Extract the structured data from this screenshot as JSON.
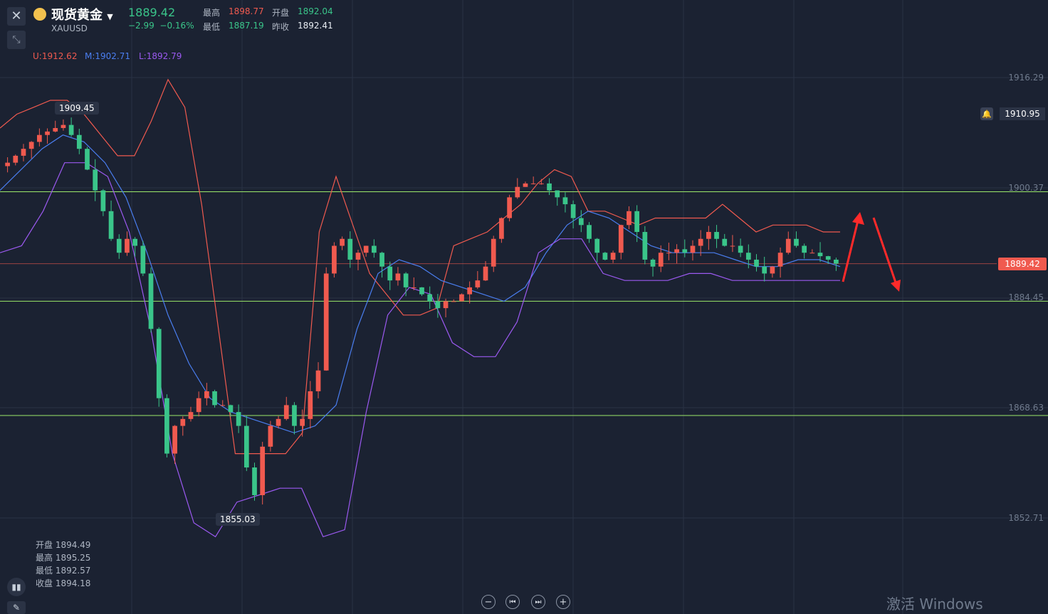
{
  "instrument": {
    "name": "现货黄金",
    "code": "XAUUSD",
    "price": "1889.42",
    "change": "−2.99",
    "change_pct": "−0.16%"
  },
  "stats": {
    "high_label": "最高",
    "high": "1898.77",
    "open_label": "开盘",
    "open": "1892.04",
    "low_label": "最低",
    "low": "1887.19",
    "prev_close_label": "昨收",
    "prev_close": "1892.41"
  },
  "bollinger_legend": {
    "upper": "U:1912.62",
    "middle": "M:1902.71",
    "lower": "L:1892.79"
  },
  "alert_price": "1910.95",
  "current_price_tag": "1889.42",
  "annotations": {
    "high_marker": "1909.45",
    "low_marker": "1855.03"
  },
  "ohlc_readout": {
    "open": "开盘 1894.49",
    "high": "最高 1895.25",
    "low": "最低 1892.57",
    "close": "收盘 1894.18"
  },
  "controls": {
    "zoom_out": "−",
    "prev": "⏮",
    "next": "⏭",
    "zoom_in": "+"
  },
  "watermark": "激活 Windows",
  "colors": {
    "bg": "#1b2232",
    "up": "#f05a4f",
    "down": "#3ac58a",
    "upper_band": "#f05a4f",
    "middle_band": "#4a7ef0",
    "lower_band": "#9b59f0",
    "hline": "#9be86a"
  },
  "chart_data": {
    "type": "candlestick",
    "y_ticks": [
      "1916.29",
      "1900.37",
      "1884.45",
      "1868.63",
      "1852.71"
    ],
    "ylim": [
      1847.5,
      1925
    ],
    "horizontal_lines": [
      1899.8,
      1884.0,
      1867.5
    ],
    "current_price": 1889.42,
    "close_series": [
      1904,
      1905,
      1906,
      1907,
      1908,
      1908.5,
      1909,
      1909.45,
      1908,
      1906,
      1903,
      1900,
      1897,
      1893,
      1891,
      1893,
      1892,
      1888,
      1880,
      1870,
      1862,
      1866,
      1867,
      1868,
      1870,
      1871,
      1869,
      1869,
      1868,
      1866,
      1860,
      1856,
      1863,
      1866,
      1867,
      1869,
      1866,
      1867,
      1871,
      1874,
      1888,
      1892,
      1893,
      1890,
      1891,
      1892,
      1891,
      1889,
      1887,
      1888,
      1886,
      1886,
      1885,
      1884,
      1883,
      1884,
      1884,
      1885,
      1886,
      1887,
      1889,
      1893,
      1896,
      1899,
      1900.5,
      1901,
      1901,
      1901,
      1900,
      1899,
      1898,
      1896,
      1895,
      1893,
      1891,
      1890,
      1891,
      1895,
      1897,
      1894,
      1890,
      1889,
      1891,
      1891,
      1891.5,
      1891,
      1892,
      1893,
      1894,
      1893,
      1892,
      1892,
      1891,
      1890,
      1889,
      1888,
      1889,
      1891,
      1893,
      1892,
      1891,
      1891,
      1890.5,
      1890,
      1889.42
    ],
    "upper_band": [
      1909,
      1911,
      1912,
      1913,
      1913,
      1911,
      1908,
      1905,
      1905,
      1910,
      1916,
      1912,
      1898,
      1880,
      1862,
      1862,
      1862,
      1862,
      1865,
      1894,
      1902,
      1895,
      1888,
      1885,
      1882,
      1882,
      1883,
      1892,
      1893,
      1894,
      1896,
      1898,
      1901,
      1903,
      1902,
      1897,
      1897,
      1896,
      1895,
      1896,
      1896,
      1896,
      1896,
      1898,
      1896,
      1894,
      1895,
      1895,
      1895,
      1894,
      1894
    ],
    "middle_band": [
      1900,
      1903,
      1906,
      1908,
      1907,
      1904,
      1899,
      1891,
      1882,
      1875,
      1870,
      1868,
      1867,
      1866,
      1865,
      1866,
      1869,
      1880,
      1888,
      1890,
      1889,
      1887,
      1886,
      1885,
      1884,
      1886,
      1891,
      1895,
      1897,
      1896,
      1894,
      1892,
      1891,
      1891,
      1891,
      1890,
      1889,
      1889,
      1890,
      1890,
      1889
    ],
    "lower_band": [
      1891,
      1892,
      1897,
      1904,
      1904,
      1902,
      1894,
      1880,
      1862,
      1852,
      1850,
      1855,
      1856,
      1857,
      1857,
      1850,
      1851,
      1868,
      1882,
      1886,
      1885,
      1878,
      1876,
      1876,
      1881,
      1891,
      1893,
      1893,
      1888,
      1887,
      1887,
      1887,
      1888,
      1888,
      1887,
      1887,
      1887,
      1887,
      1887,
      1887
    ]
  }
}
